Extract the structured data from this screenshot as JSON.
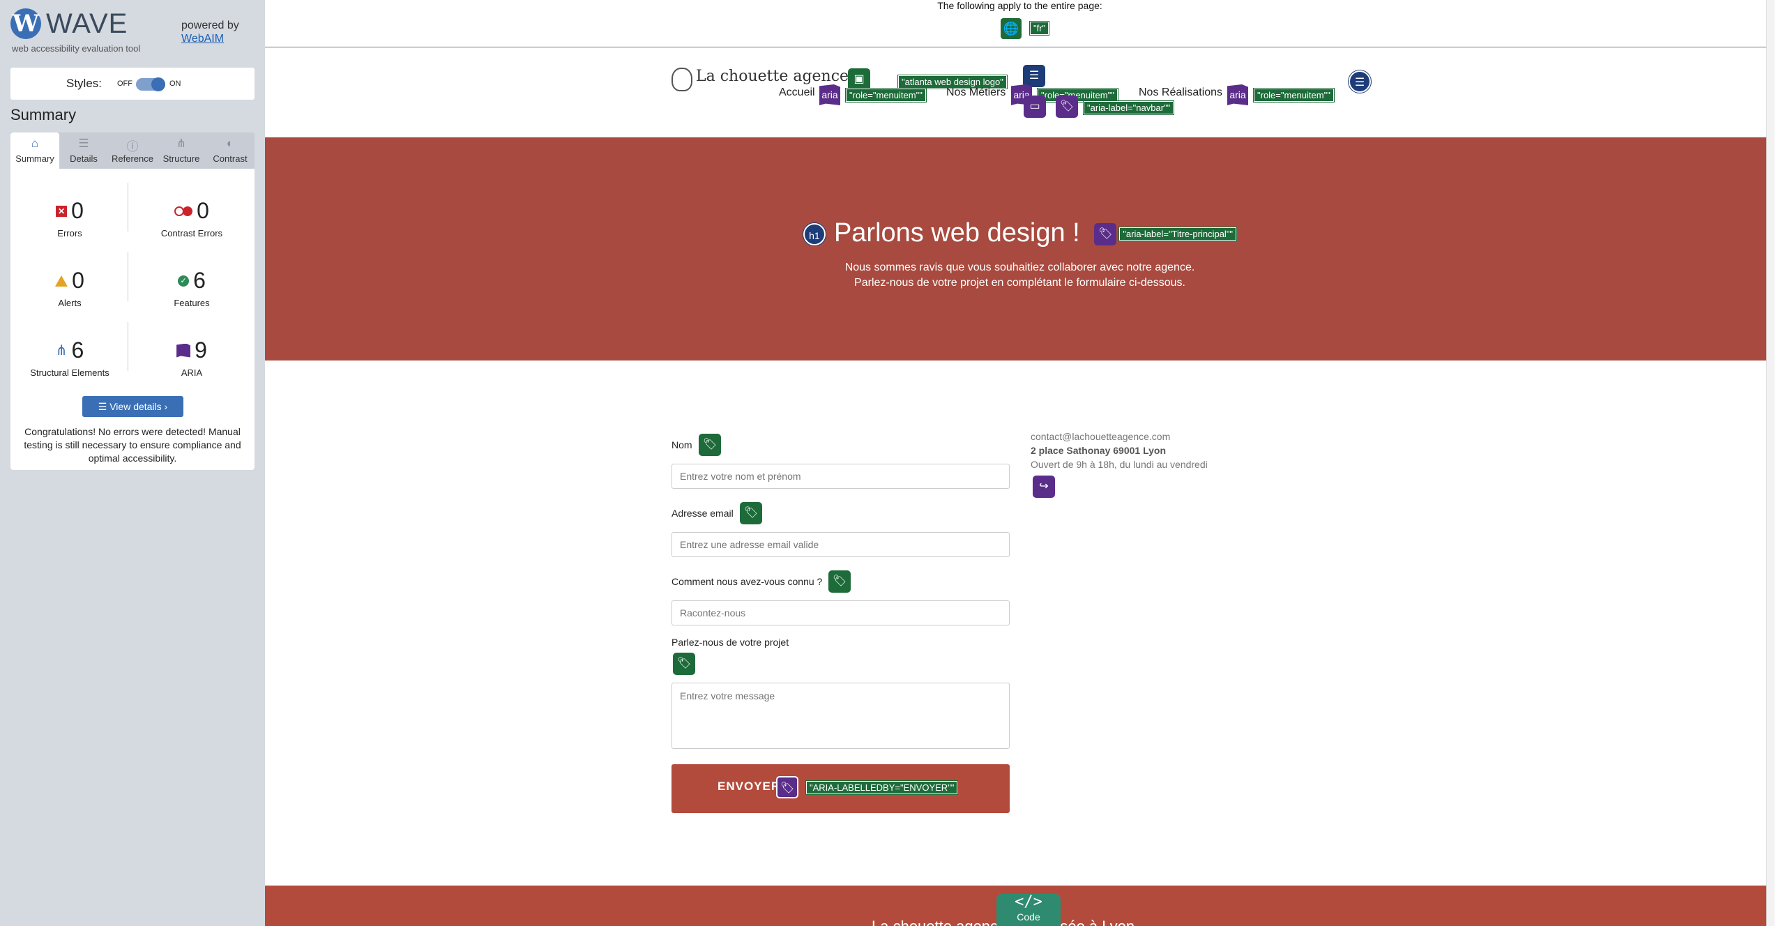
{
  "wave": {
    "logo_letter": "W",
    "title": "WAVE",
    "tagline": "web accessibility evaluation tool",
    "powered_by": "powered by",
    "webaim": "WebAIM",
    "styles_label": "Styles:",
    "styles_off": "OFF",
    "styles_on": "ON",
    "summary_heading": "Summary",
    "tabs": [
      {
        "label": "Summary",
        "icon": "home-icon",
        "glyph": "⌂"
      },
      {
        "label": "Details",
        "icon": "list-icon",
        "glyph": "☰"
      },
      {
        "label": "Reference",
        "icon": "info-icon",
        "glyph": "ⓘ"
      },
      {
        "label": "Structure",
        "icon": "structure-icon",
        "glyph": "⋔"
      },
      {
        "label": "Contrast",
        "icon": "contrast-icon",
        "glyph": "◐"
      }
    ],
    "stats": {
      "errors": {
        "value": "0",
        "label": "Errors"
      },
      "contrast_errors": {
        "value": "0",
        "label": "Contrast Errors"
      },
      "alerts": {
        "value": "0",
        "label": "Alerts"
      },
      "features": {
        "value": "6",
        "label": "Features"
      },
      "structural": {
        "value": "6",
        "label": "Structural Elements"
      },
      "aria": {
        "value": "9",
        "label": "ARIA"
      }
    },
    "view_details": "☰  View details ›",
    "congrats": "Congratulations! No errors were detected! Manual testing is still necessary to ensure compliance and optimal accessibility."
  },
  "page": {
    "top_note": "The following apply to the entire page:",
    "lang_tag": "\"fr\"",
    "logo_text": "La chouette agence",
    "logo_alt_tag": "\"atlanta web design logo\"",
    "nav": {
      "accueil": "Accueil",
      "metiers": "Nos Métiers",
      "realisations": "Nos Réalisations",
      "aria_badge": "aria",
      "role_menuitem": "\"role=\"menuitem\"\"",
      "navbar_tag": "\"aria-label=\"navbar\"\""
    },
    "hero": {
      "h1_badge": "h1",
      "title": "Parlons web design !",
      "title_tag": "\"aria-label=\"Titre-principal\"\"",
      "sub1": "Nous sommes ravis que vous souhaitiez collaborer avec notre agence.",
      "sub2": "Parlez-nous de votre projet en complétant le formulaire ci-dessous."
    },
    "form": {
      "nom_label": "Nom",
      "nom_placeholder": "Entrez votre nom et prénom",
      "email_label": "Adresse email",
      "email_placeholder": "Entrez une adresse email valide",
      "connu_label": "Comment nous avez-vous connu ?",
      "connu_placeholder": "Racontez-nous",
      "projet_label": "Parlez-nous de votre projet",
      "projet_placeholder": "Entrez votre message",
      "submit_label": "ENVOYER",
      "submit_tag": "\"ARIA-LABELLEDBY=\"ENVOYER\"\""
    },
    "contact": {
      "email": "contact@lachouetteagence.com",
      "address": "2 place Sathonay 69001 Lyon",
      "hours": "Ouvert de 9h à 18h, du lundi au vendredi"
    },
    "footer_text": "La chouette agence web basée à Lyon",
    "code_glyph": "</>",
    "code_label": "Code"
  }
}
